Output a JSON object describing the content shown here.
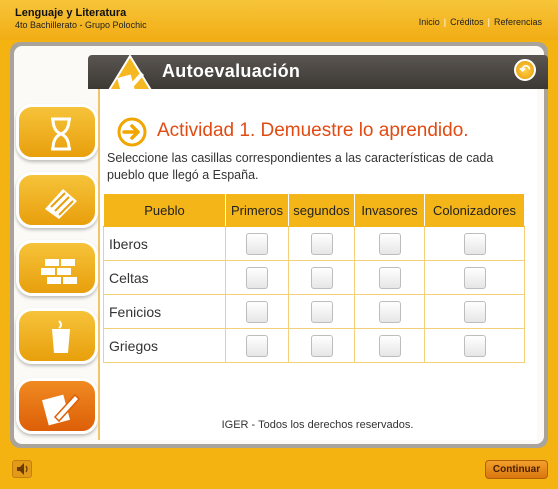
{
  "header": {
    "title": "Lenguaje y Literatura",
    "subtitle": "4to Bachillerato - Grupo Polochic",
    "nav": [
      "Inicio",
      "Créditos",
      "Referencias"
    ]
  },
  "section": {
    "title": "Autoevaluación"
  },
  "activity": {
    "title": "Actividad 1. Demuestre lo aprendido.",
    "instructions": "Seleccione las casillas correspondientes a las características de cada pueblo que llegó a España."
  },
  "table": {
    "headers": [
      "Pueblo",
      "Primeros",
      "segundos",
      "Invasores",
      "Colonizadores"
    ],
    "rows": [
      {
        "name": "Iberos",
        "checked": [
          false,
          false,
          false,
          false
        ]
      },
      {
        "name": "Celtas",
        "checked": [
          false,
          false,
          false,
          false
        ]
      },
      {
        "name": "Fenicios",
        "checked": [
          false,
          false,
          false,
          false
        ]
      },
      {
        "name": "Griegos",
        "checked": [
          false,
          false,
          false,
          false
        ]
      }
    ]
  },
  "footer": {
    "note": "IGER - Todos los derechos reservados."
  },
  "controls": {
    "continue_label": "Continuar"
  },
  "colors": {
    "accent": "#f4b518",
    "activity_title": "#e14b12",
    "band": "#3c3935"
  }
}
